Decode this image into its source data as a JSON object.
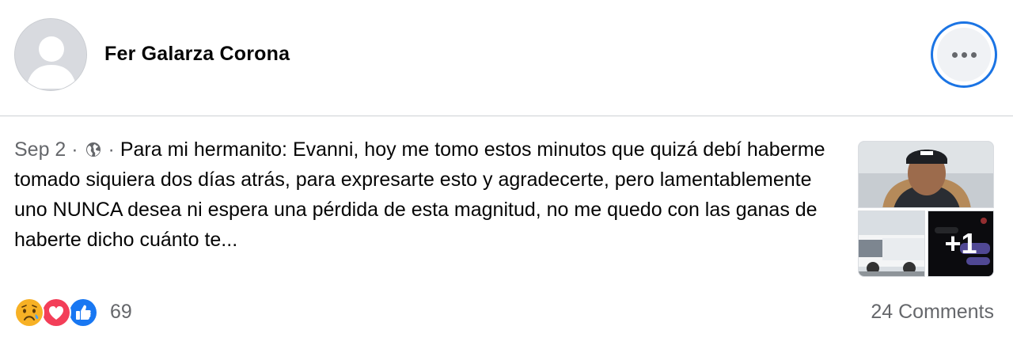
{
  "post": {
    "author": "Fer Galarza Corona",
    "date": "Sep 2",
    "separator": "·",
    "audience_icon": "globe-icon",
    "text": "Para mi hermanito: Evanni, hoy me tomo estos minutos que quizá debí haberme tomado siquiera dos días atrás, para expresarte esto y agradecerte, pero lamentablemente uno NUNCA desea ni espera una pérdida de esta magnitud, no me quedo con las ganas de haberte dicho cuánto te...",
    "more_photos_label": "+1"
  },
  "footer": {
    "reactions": [
      "sad-reaction-icon",
      "love-reaction-icon",
      "like-reaction-icon"
    ],
    "reaction_count": "69",
    "comments": "24 Comments"
  },
  "colors": {
    "accent": "#1b74e4",
    "secondary_text": "#65676b",
    "divider": "#ced0d4"
  }
}
